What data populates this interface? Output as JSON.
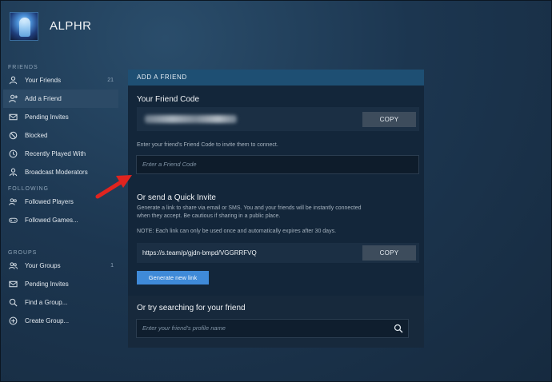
{
  "profile": {
    "username": "ALPHR"
  },
  "sidebar": {
    "sections": {
      "friends": "FRIENDS",
      "following": "FOLLOWING",
      "groups": "GROUPS"
    },
    "friends_items": [
      {
        "label": "Your Friends",
        "count": "21",
        "icon": "person-icon"
      },
      {
        "label": "Add a Friend",
        "icon": "add-person-icon",
        "active": true
      },
      {
        "label": "Pending Invites",
        "icon": "envelope-icon"
      },
      {
        "label": "Blocked",
        "icon": "blocked-icon"
      },
      {
        "label": "Recently Played With",
        "icon": "clock-icon"
      },
      {
        "label": "Broadcast Moderators",
        "icon": "moderator-icon"
      }
    ],
    "following_items": [
      {
        "label": "Followed Players",
        "icon": "people-icon"
      },
      {
        "label": "Followed Games...",
        "icon": "controller-icon"
      }
    ],
    "groups_items": [
      {
        "label": "Your Groups",
        "count": "1",
        "icon": "group-icon"
      },
      {
        "label": "Pending Invites",
        "icon": "envelope-icon"
      },
      {
        "label": "Find a Group...",
        "icon": "magnifier-icon"
      },
      {
        "label": "Create Group...",
        "icon": "plus-circle-icon"
      }
    ]
  },
  "panel": {
    "title": "ADD A FRIEND",
    "friend_code_heading": "Your Friend Code",
    "copy_label": "COPY",
    "friend_code_hint": "Enter your friend's Friend Code to invite them to connect.",
    "friend_code_placeholder": "Enter a Friend Code",
    "quick_invite_heading": "Or send a Quick Invite",
    "quick_invite_desc_line1": "Generate a link to share via email or SMS. You and your friends will be instantly connected",
    "quick_invite_desc_line2": "when they accept. Be cautious if sharing in a public place.",
    "quick_invite_note": "NOTE: Each link can only be used once and automatically expires after 30 days.",
    "invite_link": "https://s.team/p/gjdn-bmpd/VGGRRFVQ",
    "generate_label": "Generate new link",
    "search_heading": "Or try searching for your friend",
    "search_placeholder": "Enter your friend's profile name"
  },
  "colors": {
    "accent_blue": "#3f8ad8",
    "panel_header": "#1e4f73",
    "arrow_red": "#e0241f"
  }
}
